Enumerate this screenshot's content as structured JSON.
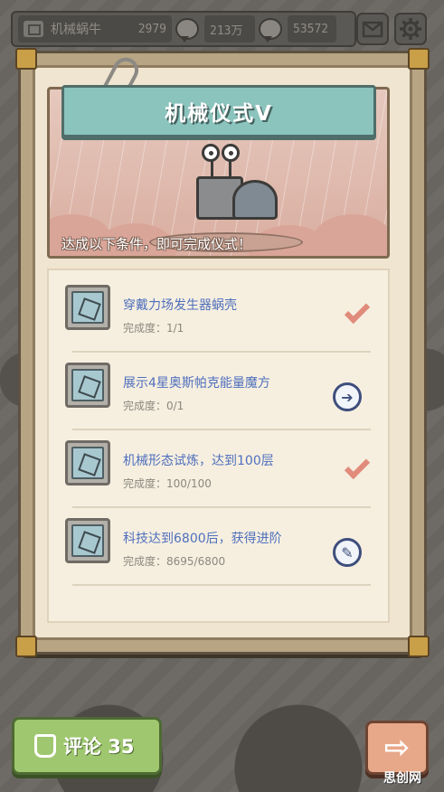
{
  "topbar": {
    "player_name": "机械蜗牛",
    "resource1": "2979",
    "resource2": "213万",
    "resource3": "53572"
  },
  "icons": {
    "mail": "mail-icon",
    "settings": "gear-icon"
  },
  "ritual": {
    "title": "机械仪式V",
    "condition_text": "达成以下条件，即可完成仪式！"
  },
  "tasks": [
    {
      "title": "穿戴力场发生器蜗壳",
      "progress": "完成度：1/1",
      "status": "done"
    },
    {
      "title": "展示4星奥斯帕克能量魔方",
      "progress": "完成度：0/1",
      "status": "go"
    },
    {
      "title": "机械形态试炼，达到100层",
      "progress": "完成度：100/100",
      "status": "done"
    },
    {
      "title": "科技达到6800后，获得进阶",
      "progress": "完成度：8695/6800",
      "status": "edit"
    }
  ],
  "bottom": {
    "comment_label": "评论 35",
    "next_arrow": "⇨",
    "watermark": "思创网"
  },
  "colors": {
    "banner": "#8bc3bd",
    "task_title": "#4f6fbd",
    "check": "#e08b7b",
    "comment_button": "#9fc76f",
    "next_button": "#e7a889"
  }
}
